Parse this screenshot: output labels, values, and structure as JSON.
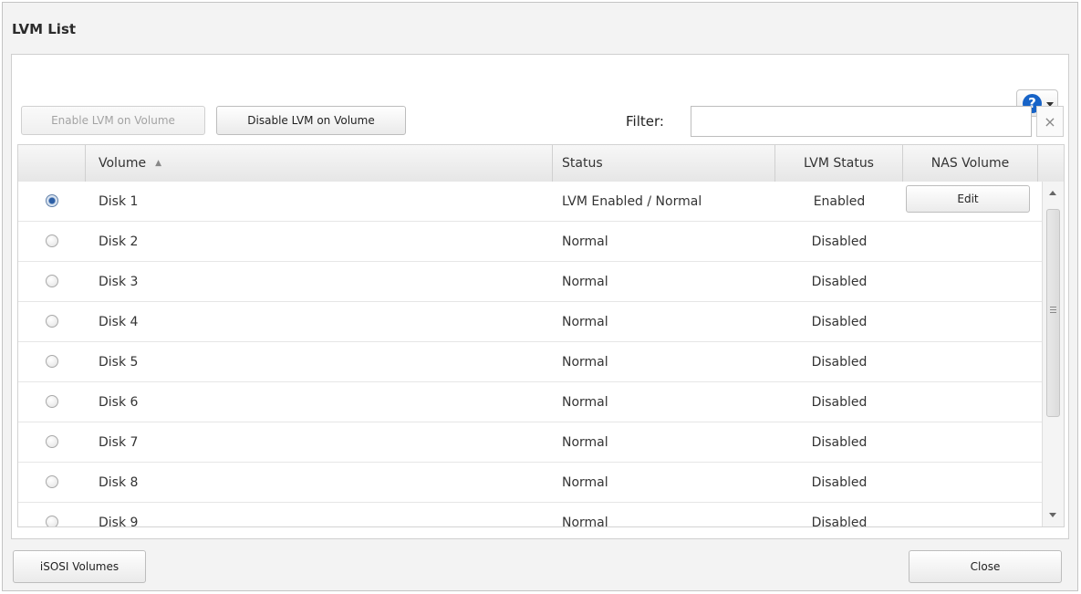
{
  "window": {
    "title": "LVM List"
  },
  "toolbar": {
    "help_glyph": "?",
    "enable_label": "Enable LVM on Volume",
    "disable_label": "Disable LVM on Volume",
    "filter_label": "Filter:",
    "filter_value": "",
    "filter_placeholder": "",
    "clear_glyph": "×"
  },
  "table": {
    "columns": [
      "",
      "Volume",
      "Status",
      "LVM Status",
      "NAS Volume"
    ],
    "sort_glyph": "▲",
    "rows": [
      {
        "selected": true,
        "volume": "Disk 1",
        "status": "LVM Enabled / Normal",
        "lvm_status": "Enabled",
        "nas_action": "Edit"
      },
      {
        "selected": false,
        "volume": "Disk 2",
        "status": "Normal",
        "lvm_status": "Disabled",
        "nas_action": ""
      },
      {
        "selected": false,
        "volume": "Disk 3",
        "status": "Normal",
        "lvm_status": "Disabled",
        "nas_action": ""
      },
      {
        "selected": false,
        "volume": "Disk 4",
        "status": "Normal",
        "lvm_status": "Disabled",
        "nas_action": ""
      },
      {
        "selected": false,
        "volume": "Disk 5",
        "status": "Normal",
        "lvm_status": "Disabled",
        "nas_action": ""
      },
      {
        "selected": false,
        "volume": "Disk 6",
        "status": "Normal",
        "lvm_status": "Disabled",
        "nas_action": ""
      },
      {
        "selected": false,
        "volume": "Disk 7",
        "status": "Normal",
        "lvm_status": "Disabled",
        "nas_action": ""
      },
      {
        "selected": false,
        "volume": "Disk 8",
        "status": "Normal",
        "lvm_status": "Disabled",
        "nas_action": ""
      },
      {
        "selected": false,
        "volume": "Disk 9",
        "status": "Normal",
        "lvm_status": "Disabled",
        "nas_action": ""
      }
    ]
  },
  "footer": {
    "iscsi_label": "iSOSI Volumes",
    "close_label": "Close"
  },
  "colors": {
    "help_accent": "#1763c7",
    "radio_selected": "#2d5fa6"
  }
}
